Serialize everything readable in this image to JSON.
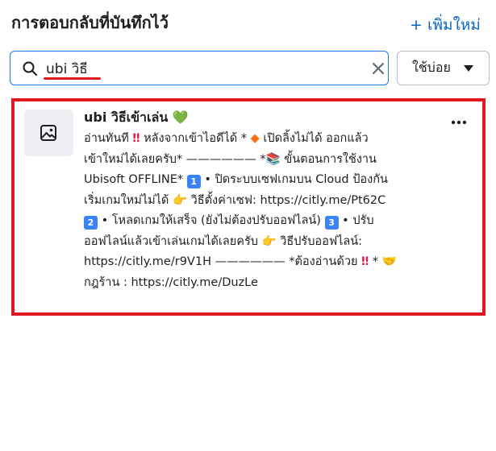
{
  "header": {
    "title": "การตอบกลับที่บันทึกไว้",
    "add_new_label": "+ เพิ่มใหม่"
  },
  "search": {
    "value": "ubi วิธี",
    "placeholder": ""
  },
  "sort": {
    "label": "ใช้บ่อย"
  },
  "result": {
    "title": "ubi วิธีเข้าเล่น",
    "title_emoji": "💚",
    "lines": [
      [
        "อ่านทันที ",
        "‼",
        "  หลังจากเข้าไอดีได้ * ",
        "◆",
        "  เปิดลิ้งไม่ได้ ออกแล้ว"
      ],
      [
        "เข้าใหม่ได้เลยครับ* —————— *📚  ขั้นตอนการใช้งาน"
      ],
      [
        "Ubisoft OFFLINE* ",
        "1",
        "  • ปิดระบบเซฟเกมบน Cloud ป้องกัน"
      ],
      [
        "เริ่มเกมใหม่ไม่ได้  👉  วิธีตั้งค่าเซฟ: https://citly.me/Pt62C"
      ],
      [
        "2",
        "  • โหลดเกมให้เสร็จ (ยังไม่ต้องปรับออฟไลน์)  ",
        "3",
        "  • ปรับ"
      ],
      [
        "ออฟไลน์แล้วเข้าเล่นเกมได้เลยครับ  👉  วิธีปรับออฟไลน์:"
      ],
      [
        "https://citly.me/r9V1H —————— *ต้องอ่านด้วย  ",
        "‼",
        " *  🤝"
      ],
      [
        "กฎร้าน : https://citly.me/DuzLe"
      ]
    ]
  },
  "icons": {
    "search": "search-icon",
    "clear": "close-icon",
    "sort_caret": "caret-down-icon",
    "thumbnail": "image-icon",
    "more": "more-horizontal-icon"
  },
  "colors": {
    "accent": "#0a66c2",
    "highlight": "#e0171e",
    "search_border": "#1877f2"
  }
}
